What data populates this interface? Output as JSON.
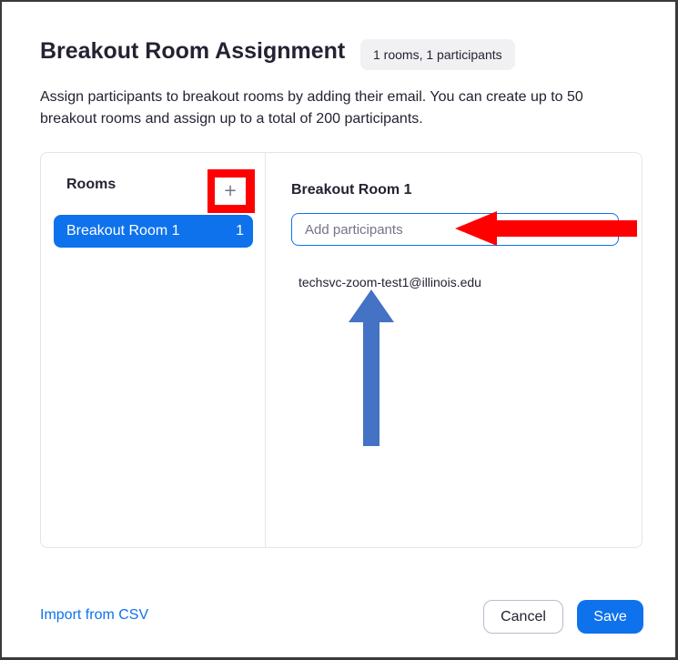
{
  "dialog": {
    "title": "Breakout Room Assignment",
    "count_badge": "1 rooms, 1 participants",
    "description": "Assign participants to breakout rooms by adding their email. You can create up to 50 breakout rooms and assign up to a total of 200 participants."
  },
  "rooms": {
    "header": "Rooms",
    "add_glyph": "+",
    "items": [
      {
        "label": "Breakout Room 1",
        "count": "1"
      }
    ]
  },
  "selected_room": {
    "title": "Breakout Room 1",
    "input_placeholder": "Add participants",
    "participants": [
      "techsvc-zoom-test1@illinois.edu"
    ]
  },
  "footer": {
    "import_link": "Import from CSV",
    "cancel_label": "Cancel",
    "save_label": "Save"
  },
  "colors": {
    "accent": "#0e72ed",
    "annotation_red": "#ff0000",
    "annotation_blue": "#4472c4"
  }
}
